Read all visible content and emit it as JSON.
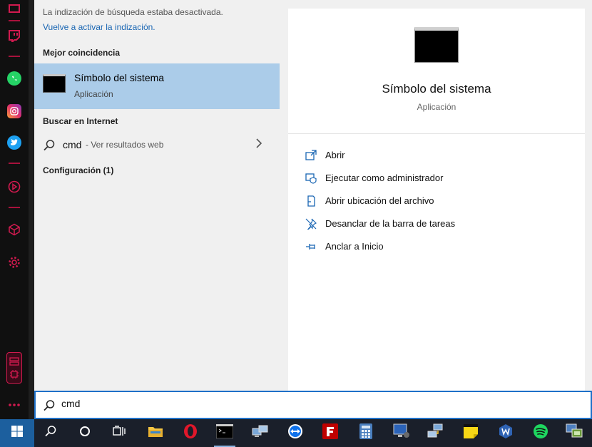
{
  "notice": {
    "text": "La indización de búsqueda estaba desactivada.",
    "link": "Vuelve a activar la indización."
  },
  "best_match": {
    "header": "Mejor coincidencia",
    "title": "Símbolo del sistema",
    "subtitle": "Aplicación"
  },
  "web": {
    "header": "Buscar en Internet",
    "term": "cmd",
    "suffix": "- Ver resultados web"
  },
  "config": {
    "header": "Configuración (1)"
  },
  "preview": {
    "title": "Símbolo del sistema",
    "subtitle": "Aplicación",
    "actions": [
      {
        "label": "Abrir",
        "icon": "open-icon"
      },
      {
        "label": "Ejecutar como administrador",
        "icon": "shield-icon"
      },
      {
        "label": "Abrir ubicación del archivo",
        "icon": "file-location-icon"
      },
      {
        "label": "Desanclar de la barra de tareas",
        "icon": "unpin-icon"
      },
      {
        "label": "Anclar a Inicio",
        "icon": "pin-icon"
      }
    ]
  },
  "search": {
    "value": "cmd"
  },
  "colors": {
    "accent": "#1e70c8",
    "selection": "#abcce9",
    "sidebar_accent": "#a8123c"
  }
}
